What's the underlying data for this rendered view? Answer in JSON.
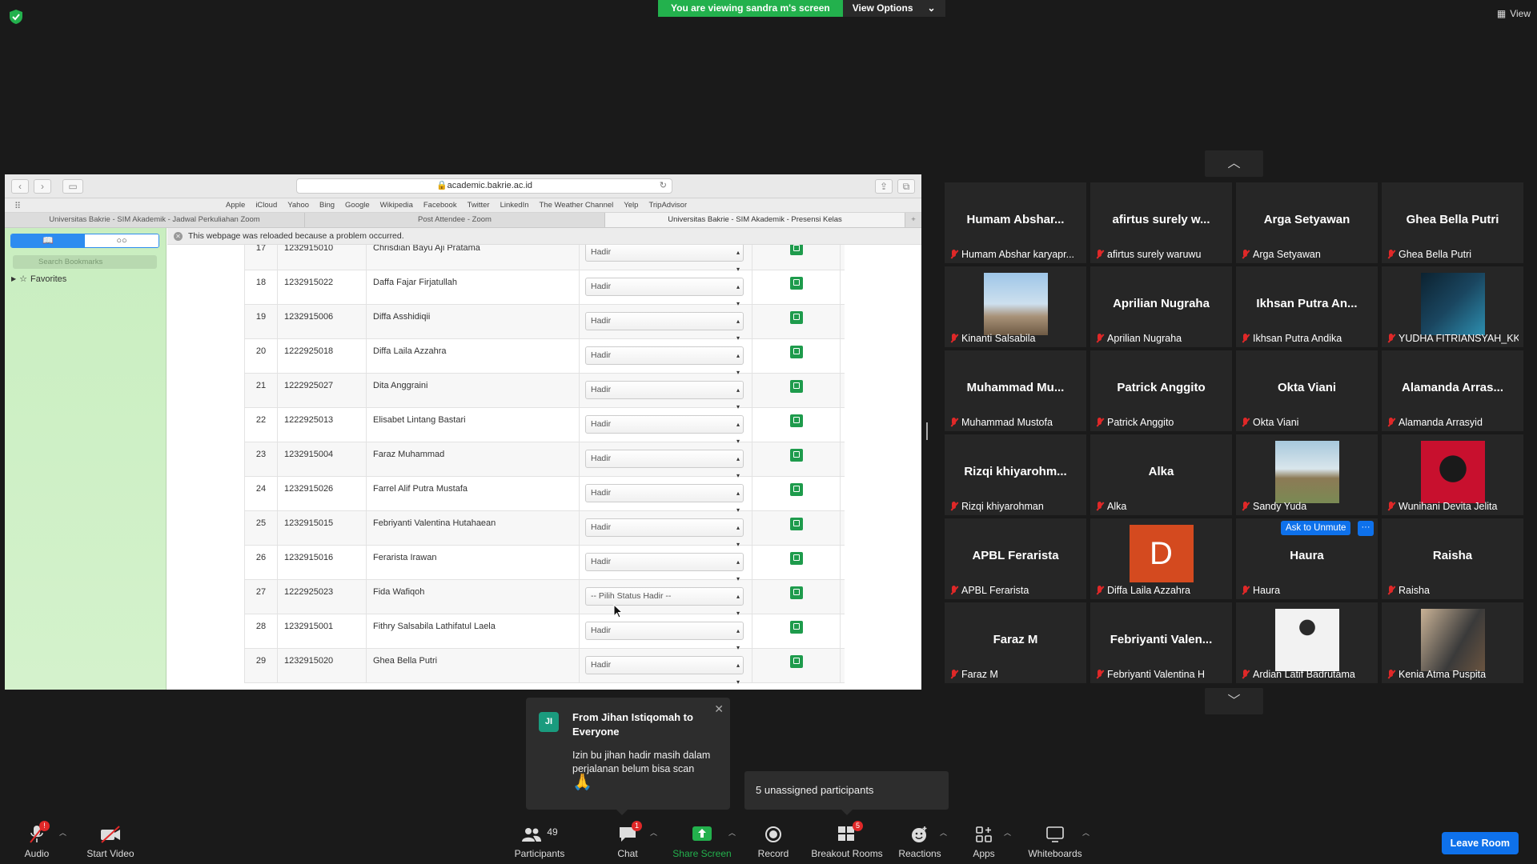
{
  "banner": {
    "viewing": "You are viewing sandra m's screen",
    "view_options": "View Options"
  },
  "top_right": {
    "view": "View"
  },
  "browser": {
    "url": "academic.bakrie.ac.id",
    "favorites": [
      "Apple",
      "iCloud",
      "Yahoo",
      "Bing",
      "Google",
      "Wikipedia",
      "Facebook",
      "Twitter",
      "LinkedIn",
      "The Weather Channel",
      "Yelp",
      "TripAdvisor"
    ],
    "tabs": [
      "Universitas Bakrie - SIM Akademik - Jadwal Perkuliahan Zoom",
      "Post Attendee - Zoom",
      "Universitas Bakrie - SIM Akademik - Presensi Kelas"
    ],
    "notice": "This webpage was reloaded because a problem occurred.",
    "sidebar": {
      "search_placeholder": "Search Bookmarks",
      "favorites": "Favorites"
    }
  },
  "attendance": [
    {
      "no": "17",
      "nim": "1232915010",
      "name": "Chrisdian Bayu Aji Pratama",
      "status": "Hadir"
    },
    {
      "no": "18",
      "nim": "1232915022",
      "name": "Daffa Fajar Firjatullah",
      "status": "Hadir"
    },
    {
      "no": "19",
      "nim": "1232915006",
      "name": "Diffa Asshidiqii",
      "status": "Hadir"
    },
    {
      "no": "20",
      "nim": "1222925018",
      "name": "Diffa Laila Azzahra",
      "status": "Hadir"
    },
    {
      "no": "21",
      "nim": "1222925027",
      "name": "Dita Anggraini",
      "status": "Hadir"
    },
    {
      "no": "22",
      "nim": "1222925013",
      "name": "Elisabet Lintang Bastari",
      "status": "Hadir"
    },
    {
      "no": "23",
      "nim": "1232915004",
      "name": "Faraz Muhammad",
      "status": "Hadir"
    },
    {
      "no": "24",
      "nim": "1232915026",
      "name": "Farrel Alif Putra Mustafa",
      "status": "Hadir"
    },
    {
      "no": "25",
      "nim": "1232915015",
      "name": "Febriyanti Valentina Hutahaean",
      "status": "Hadir"
    },
    {
      "no": "26",
      "nim": "1232915016",
      "name": "Ferarista Irawan",
      "status": "Hadir"
    },
    {
      "no": "27",
      "nim": "1222925023",
      "name": "Fida Wafiqoh",
      "status": "-- Pilih Status Hadir --"
    },
    {
      "no": "28",
      "nim": "1232915001",
      "name": "Fithry Salsabila Lathifatul Laela",
      "status": "Hadir"
    },
    {
      "no": "29",
      "nim": "1232915020",
      "name": "Ghea Bella Putri",
      "status": "Hadir"
    }
  ],
  "participants": [
    {
      "big": "Humam  Abshar...",
      "name": "Humam Abshar karyapr..."
    },
    {
      "big": "afirtus  surely  w...",
      "name": "afirtus surely waruwu"
    },
    {
      "big": "Arga Setyawan",
      "name": "Arga Setyawan"
    },
    {
      "big": "Ghea Bella Putri",
      "name": "Ghea Bella Putri"
    },
    {
      "big": "",
      "name": "Kinanti Salsabila",
      "photo": "p1"
    },
    {
      "big": "Aprilian Nugraha",
      "name": "Aprilian Nugraha"
    },
    {
      "big": "Ikhsan Putra An...",
      "name": "Ikhsan Putra Andika"
    },
    {
      "big": "",
      "name": "YUDHA FITRIANSYAH_KK",
      "photo": "p2"
    },
    {
      "big": "Muhammad  Mu...",
      "name": "Muhammad Mustofa"
    },
    {
      "big": "Patrick Anggito",
      "name": "Patrick Anggito"
    },
    {
      "big": "Okta Viani",
      "name": "Okta Viani"
    },
    {
      "big": "Alamanda  Arras...",
      "name": "Alamanda Arrasyid"
    },
    {
      "big": "Rizqi  khiyarohm...",
      "name": "Rizqi khiyarohman"
    },
    {
      "big": "Alka",
      "name": "Alka"
    },
    {
      "big": "",
      "name": "Sandy Yuda",
      "photo": "p3"
    },
    {
      "big": "",
      "name": "Wunihani Devita Jelita",
      "photo": "p4"
    },
    {
      "big": "APBL Ferarista",
      "name": "APBL Ferarista"
    },
    {
      "big": "",
      "name": "Diffa Laila Azzahra",
      "letter": "D"
    },
    {
      "big": "Haura",
      "name": "Haura",
      "unmute": "Ask to Unmute"
    },
    {
      "big": "Raisha",
      "name": "Raisha"
    },
    {
      "big": "Faraz M",
      "name": "Faraz M"
    },
    {
      "big": "Febriyanti  Valen...",
      "name": "Febriyanti Valentina H"
    },
    {
      "big": "",
      "name": "Ardian Latif Badrutama",
      "photo": "p5"
    },
    {
      "big": "",
      "name": "Kenia Atma Puspita",
      "photo": "p6"
    }
  ],
  "chat_popup": {
    "initials": "JI",
    "from": "From Jihan Istiqomah to Everyone",
    "message": "Izin bu jihan hadir masih dalam perjalanan belum bisa scan",
    "emoji": "🙏"
  },
  "unassigned": "5 unassigned participants",
  "toolbar": {
    "audio": "Audio",
    "audio_badge": "!",
    "video": "Start Video",
    "participants": "Participants",
    "participants_count": "49",
    "chat": "Chat",
    "chat_badge": "1",
    "share": "Share Screen",
    "record": "Record",
    "breakout": "Breakout Rooms",
    "breakout_count": "5",
    "reactions": "Reactions",
    "apps": "Apps",
    "whiteboards": "Whiteboards",
    "leave": "Leave Room"
  },
  "colors": {
    "green": "#23b14d",
    "blue": "#0e71eb",
    "muted_red": "#e02828",
    "tile": "#262626"
  }
}
